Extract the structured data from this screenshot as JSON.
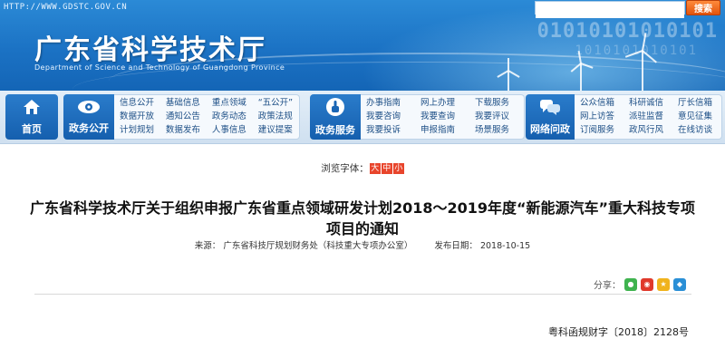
{
  "header": {
    "url": "HTTP://WWW.GDSTC.GOV.CN",
    "title": "广东省科学技术厅",
    "subtitle": "Department of Science and Technology of Guangdong Province",
    "binary_text": "01010101010101",
    "binary_text2": "1010101010101",
    "search": {
      "value": "",
      "placeholder": "",
      "button_label": "搜索"
    }
  },
  "nav": {
    "home": {
      "label": "首页",
      "icon": "home-icon"
    },
    "gov_open": {
      "label": "政务公开",
      "icon": "eye-icon",
      "links": [
        "信息公开",
        "数据开放",
        "计划规划",
        "基础信息",
        "通知公告",
        "数据发布",
        "重点领域",
        "政务动态",
        "人事信息",
        "“五公开”",
        "政策法规",
        "建议提案"
      ]
    },
    "gov_service": {
      "label": "政务服务",
      "icon": "pointer-hand-icon",
      "links": [
        "办事指南",
        "我要咨询",
        "我要投诉",
        "网上办理",
        "我要查询",
        "申报指南",
        "下载服务",
        "我要评议",
        "场景服务"
      ]
    },
    "net_inquiry": {
      "label": "网络问政",
      "icon": "chat-bubbles-icon",
      "links": [
        "公众信箱",
        "网上访答",
        "订阅服务",
        "科研诚信",
        "派驻监督",
        "政风行风",
        "厅长信箱",
        "意见征集",
        "在线访谈"
      ]
    }
  },
  "content": {
    "font_size_label": "浏览字体：",
    "font_sizes": [
      "大",
      "中",
      "小"
    ],
    "font_size_colors": [
      "#e8452c",
      "#e8452c",
      "#e8452c"
    ],
    "title_line1": "广东省科学技术厅关于组织申报广东省重点领域研发计划2018～2019年度“新能源汽车”重大科技专项",
    "title_line2": "项目的通知",
    "source_label": "来源：",
    "source_value": "广东省科技厅规划财务处（科技重大专项办公室）",
    "date_label": "发布日期：",
    "date_value": "2018-10-15",
    "share_label": "分享：",
    "share_icons": [
      "wechat-icon",
      "weibo-icon",
      "qzone-icon",
      "qq-icon"
    ],
    "doc_number": "粤科函规财字〔2018〕2128号"
  },
  "colors": {
    "banner": "#1b72c4",
    "nav_tile": "#1e6dbd",
    "search_btn": "#e2540e"
  }
}
